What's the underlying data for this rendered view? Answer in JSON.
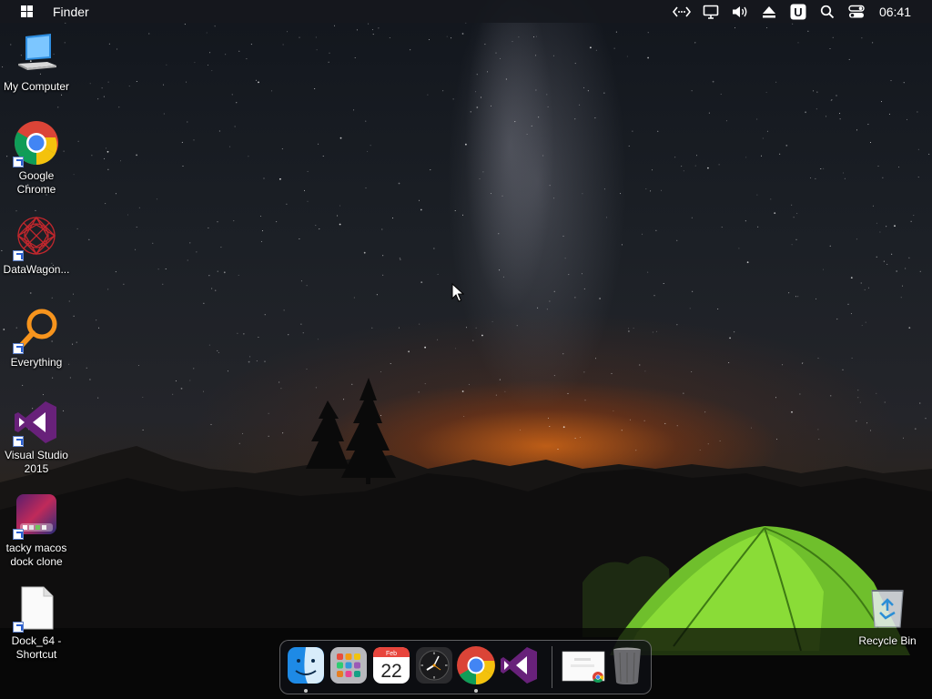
{
  "menubar": {
    "app_name": "Finder",
    "clock": "06:41",
    "status_icons": [
      "network-code-icon",
      "monitor-icon",
      "volume-icon",
      "eject-icon",
      "u-badge-icon",
      "search-icon",
      "control-center-icon"
    ],
    "u_badge_letter": "U"
  },
  "desktop": {
    "icons": [
      {
        "name": "my-computer",
        "label": "My Computer"
      },
      {
        "name": "google-chrome",
        "label": "Google Chrome"
      },
      {
        "name": "datawagon",
        "label": "DataWagon..."
      },
      {
        "name": "everything",
        "label": "Everything"
      },
      {
        "name": "visual-studio-2015",
        "label": "Visual Studio 2015"
      },
      {
        "name": "tacky-macos-dock-clone",
        "label": "tacky macos dock clone"
      },
      {
        "name": "dock-64-shortcut",
        "label": "Dock_64 - Shortcut"
      },
      {
        "name": "recycle-bin",
        "label": "Recycle Bin"
      }
    ]
  },
  "dock": {
    "items": [
      {
        "name": "finder",
        "running": true
      },
      {
        "name": "launchpad",
        "running": false
      },
      {
        "name": "calendar",
        "running": false,
        "month": "Feb",
        "day": "22"
      },
      {
        "name": "clock",
        "running": false
      },
      {
        "name": "google-chrome",
        "running": true
      },
      {
        "name": "visual-studio",
        "running": false
      },
      {
        "name": "chrome-window-preview",
        "running": false
      },
      {
        "name": "trash",
        "running": false
      }
    ]
  },
  "colors": {
    "menubar_bg": "#16181e",
    "chrome_red": "#db4437",
    "chrome_yellow": "#f4c20d",
    "chrome_green": "#0f9d58",
    "chrome_blue": "#4285f4",
    "vs_purple": "#68217a",
    "everything_orange": "#f7941d",
    "tent_green": "#7ec832"
  }
}
